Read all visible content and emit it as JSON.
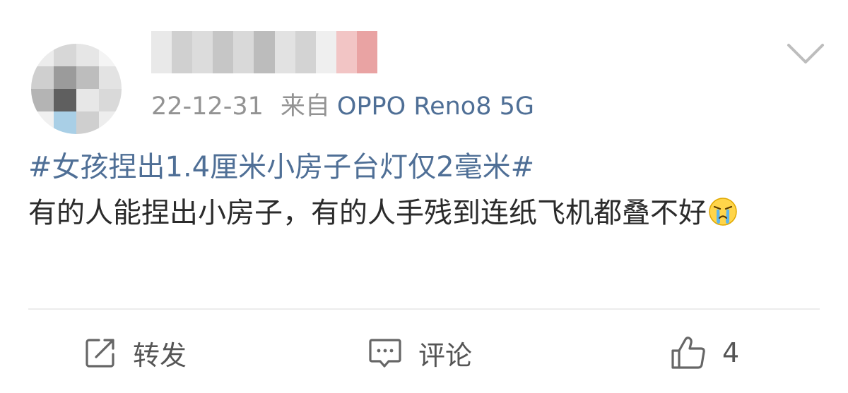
{
  "post": {
    "date": "22-12-31",
    "source_prefix": "来自",
    "device": "OPPO Reno8 5G",
    "hashtag": "#女孩捏出1.4厘米小房子台灯仅2毫米#",
    "text": "有的人能捏出小房子，有的人手残到连纸飞机都叠不好",
    "emoji": "crying-face-emoji"
  },
  "actions": {
    "repost_label": "转发",
    "comment_label": "评论",
    "like_count": "4"
  },
  "icons": {
    "more": "chevron-down-icon",
    "repost": "repost-icon",
    "comment": "comment-icon",
    "like": "thumbs-up-icon"
  },
  "colors": {
    "link_blue": "#4f6f96",
    "meta_gray": "#939393",
    "text": "#2b2b2b"
  }
}
